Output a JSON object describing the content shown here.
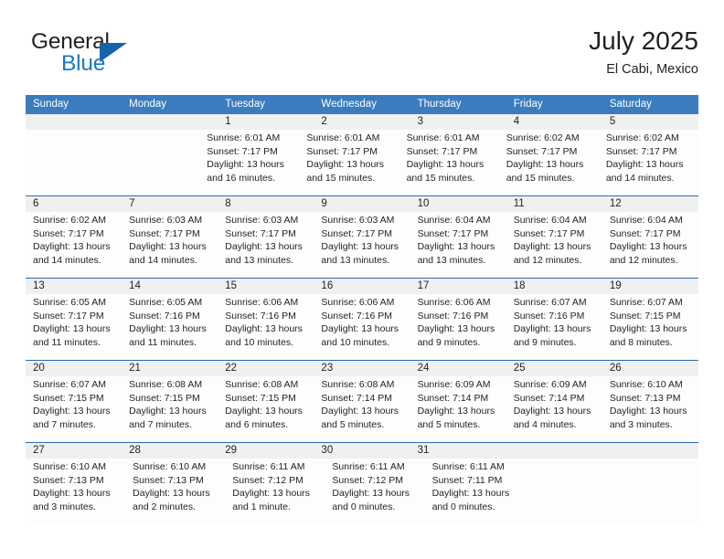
{
  "brand": {
    "word_one": "General",
    "word_two": "Blue",
    "flag_icon": "blue-triangle-flag",
    "accent_color": "#1464aa",
    "blue_text_color": "#1b7ac2"
  },
  "header": {
    "title": "July 2025",
    "location": "El Cabi, Mexico"
  },
  "theme": {
    "header_row_bg": "#3a7cbe",
    "day_number_band_bg": "#f0f0f0",
    "cell_bg": "#fdfdfd",
    "separator_color": "#2a6dad",
    "text_color": "#231f20"
  },
  "calendar": {
    "weekday_headers": [
      "Sunday",
      "Monday",
      "Tuesday",
      "Wednesday",
      "Thursday",
      "Friday",
      "Saturday"
    ],
    "weeks": [
      {
        "numbers": [
          "",
          "",
          "1",
          "2",
          "3",
          "4",
          "5"
        ],
        "cells": [
          {
            "empty": true,
            "lines": []
          },
          {
            "empty": true,
            "lines": []
          },
          {
            "empty": false,
            "lines": [
              "Sunrise: 6:01 AM",
              "Sunset: 7:17 PM",
              "Daylight: 13 hours",
              "and 16 minutes."
            ]
          },
          {
            "empty": false,
            "lines": [
              "Sunrise: 6:01 AM",
              "Sunset: 7:17 PM",
              "Daylight: 13 hours",
              "and 15 minutes."
            ]
          },
          {
            "empty": false,
            "lines": [
              "Sunrise: 6:01 AM",
              "Sunset: 7:17 PM",
              "Daylight: 13 hours",
              "and 15 minutes."
            ]
          },
          {
            "empty": false,
            "lines": [
              "Sunrise: 6:02 AM",
              "Sunset: 7:17 PM",
              "Daylight: 13 hours",
              "and 15 minutes."
            ]
          },
          {
            "empty": false,
            "lines": [
              "Sunrise: 6:02 AM",
              "Sunset: 7:17 PM",
              "Daylight: 13 hours",
              "and 14 minutes."
            ]
          }
        ]
      },
      {
        "numbers": [
          "6",
          "7",
          "8",
          "9",
          "10",
          "11",
          "12"
        ],
        "cells": [
          {
            "empty": false,
            "lines": [
              "Sunrise: 6:02 AM",
              "Sunset: 7:17 PM",
              "Daylight: 13 hours",
              "and 14 minutes."
            ]
          },
          {
            "empty": false,
            "lines": [
              "Sunrise: 6:03 AM",
              "Sunset: 7:17 PM",
              "Daylight: 13 hours",
              "and 14 minutes."
            ]
          },
          {
            "empty": false,
            "lines": [
              "Sunrise: 6:03 AM",
              "Sunset: 7:17 PM",
              "Daylight: 13 hours",
              "and 13 minutes."
            ]
          },
          {
            "empty": false,
            "lines": [
              "Sunrise: 6:03 AM",
              "Sunset: 7:17 PM",
              "Daylight: 13 hours",
              "and 13 minutes."
            ]
          },
          {
            "empty": false,
            "lines": [
              "Sunrise: 6:04 AM",
              "Sunset: 7:17 PM",
              "Daylight: 13 hours",
              "and 13 minutes."
            ]
          },
          {
            "empty": false,
            "lines": [
              "Sunrise: 6:04 AM",
              "Sunset: 7:17 PM",
              "Daylight: 13 hours",
              "and 12 minutes."
            ]
          },
          {
            "empty": false,
            "lines": [
              "Sunrise: 6:04 AM",
              "Sunset: 7:17 PM",
              "Daylight: 13 hours",
              "and 12 minutes."
            ]
          }
        ]
      },
      {
        "numbers": [
          "13",
          "14",
          "15",
          "16",
          "17",
          "18",
          "19"
        ],
        "cells": [
          {
            "empty": false,
            "lines": [
              "Sunrise: 6:05 AM",
              "Sunset: 7:17 PM",
              "Daylight: 13 hours",
              "and 11 minutes."
            ]
          },
          {
            "empty": false,
            "lines": [
              "Sunrise: 6:05 AM",
              "Sunset: 7:16 PM",
              "Daylight: 13 hours",
              "and 11 minutes."
            ]
          },
          {
            "empty": false,
            "lines": [
              "Sunrise: 6:06 AM",
              "Sunset: 7:16 PM",
              "Daylight: 13 hours",
              "and 10 minutes."
            ]
          },
          {
            "empty": false,
            "lines": [
              "Sunrise: 6:06 AM",
              "Sunset: 7:16 PM",
              "Daylight: 13 hours",
              "and 10 minutes."
            ]
          },
          {
            "empty": false,
            "lines": [
              "Sunrise: 6:06 AM",
              "Sunset: 7:16 PM",
              "Daylight: 13 hours",
              "and 9 minutes."
            ]
          },
          {
            "empty": false,
            "lines": [
              "Sunrise: 6:07 AM",
              "Sunset: 7:16 PM",
              "Daylight: 13 hours",
              "and 9 minutes."
            ]
          },
          {
            "empty": false,
            "lines": [
              "Sunrise: 6:07 AM",
              "Sunset: 7:15 PM",
              "Daylight: 13 hours",
              "and 8 minutes."
            ]
          }
        ]
      },
      {
        "numbers": [
          "20",
          "21",
          "22",
          "23",
          "24",
          "25",
          "26"
        ],
        "cells": [
          {
            "empty": false,
            "lines": [
              "Sunrise: 6:07 AM",
              "Sunset: 7:15 PM",
              "Daylight: 13 hours",
              "and 7 minutes."
            ]
          },
          {
            "empty": false,
            "lines": [
              "Sunrise: 6:08 AM",
              "Sunset: 7:15 PM",
              "Daylight: 13 hours",
              "and 7 minutes."
            ]
          },
          {
            "empty": false,
            "lines": [
              "Sunrise: 6:08 AM",
              "Sunset: 7:15 PM",
              "Daylight: 13 hours",
              "and 6 minutes."
            ]
          },
          {
            "empty": false,
            "lines": [
              "Sunrise: 6:08 AM",
              "Sunset: 7:14 PM",
              "Daylight: 13 hours",
              "and 5 minutes."
            ]
          },
          {
            "empty": false,
            "lines": [
              "Sunrise: 6:09 AM",
              "Sunset: 7:14 PM",
              "Daylight: 13 hours",
              "and 5 minutes."
            ]
          },
          {
            "empty": false,
            "lines": [
              "Sunrise: 6:09 AM",
              "Sunset: 7:14 PM",
              "Daylight: 13 hours",
              "and 4 minutes."
            ]
          },
          {
            "empty": false,
            "lines": [
              "Sunrise: 6:10 AM",
              "Sunset: 7:13 PM",
              "Daylight: 13 hours",
              "and 3 minutes."
            ]
          }
        ]
      },
      {
        "numbers": [
          "27",
          "28",
          "29",
          "30",
          "31",
          "",
          ""
        ],
        "cells": [
          {
            "empty": false,
            "lines": [
              "Sunrise: 6:10 AM",
              "Sunset: 7:13 PM",
              "Daylight: 13 hours",
              "and 3 minutes."
            ]
          },
          {
            "empty": false,
            "lines": [
              "Sunrise: 6:10 AM",
              "Sunset: 7:13 PM",
              "Daylight: 13 hours",
              "and 2 minutes."
            ]
          },
          {
            "empty": false,
            "lines": [
              "Sunrise: 6:11 AM",
              "Sunset: 7:12 PM",
              "Daylight: 13 hours",
              "and 1 minute."
            ]
          },
          {
            "empty": false,
            "lines": [
              "Sunrise: 6:11 AM",
              "Sunset: 7:12 PM",
              "Daylight: 13 hours",
              "and 0 minutes."
            ]
          },
          {
            "empty": false,
            "lines": [
              "Sunrise: 6:11 AM",
              "Sunset: 7:11 PM",
              "Daylight: 13 hours",
              "and 0 minutes."
            ]
          },
          {
            "empty": true,
            "lines": []
          },
          {
            "empty": true,
            "lines": []
          }
        ]
      }
    ]
  }
}
